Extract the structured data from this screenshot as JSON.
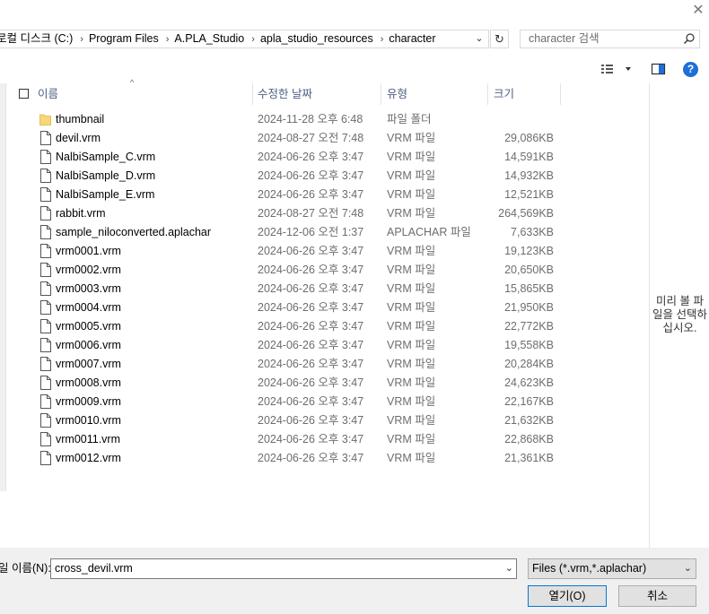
{
  "window": {
    "close_glyph": "✕"
  },
  "address": {
    "crumbs": [
      "로컬 디스크 (C:)",
      "Program Files",
      "A.PLA_Studio",
      "apla_studio_resources",
      "character"
    ],
    "separator": "›",
    "dropdown_glyph": "⌄",
    "refresh_glyph": "↻"
  },
  "search": {
    "placeholder": "character 검색",
    "icon": "search-icon"
  },
  "toolbar": {
    "help_label": "?",
    "view_icon": "view-list-icon",
    "preview_icon": "preview-pane-icon"
  },
  "columns": {
    "name": "이름",
    "date": "수정한 날짜",
    "type": "유형",
    "size": "크기",
    "sort_glyph": "^"
  },
  "files": [
    {
      "name": "thumbnail",
      "date": "2024-11-28 오후 6:48",
      "type": "파일 폴더",
      "size": "",
      "kind": "folder"
    },
    {
      "name": "devil.vrm",
      "date": "2024-08-27 오전 7:48",
      "type": "VRM 파일",
      "size": "29,086KB",
      "kind": "file"
    },
    {
      "name": "NalbiSample_C.vrm",
      "date": "2024-06-26 오후 3:47",
      "type": "VRM 파일",
      "size": "14,591KB",
      "kind": "file"
    },
    {
      "name": "NalbiSample_D.vrm",
      "date": "2024-06-26 오후 3:47",
      "type": "VRM 파일",
      "size": "14,932KB",
      "kind": "file"
    },
    {
      "name": "NalbiSample_E.vrm",
      "date": "2024-06-26 오후 3:47",
      "type": "VRM 파일",
      "size": "12,521KB",
      "kind": "file"
    },
    {
      "name": "rabbit.vrm",
      "date": "2024-08-27 오전 7:48",
      "type": "VRM 파일",
      "size": "264,569KB",
      "kind": "file"
    },
    {
      "name": "sample_niloconverted.aplachar",
      "date": "2024-12-06 오전 1:37",
      "type": "APLACHAR 파일",
      "size": "7,633KB",
      "kind": "file"
    },
    {
      "name": "vrm0001.vrm",
      "date": "2024-06-26 오후 3:47",
      "type": "VRM 파일",
      "size": "19,123KB",
      "kind": "file"
    },
    {
      "name": "vrm0002.vrm",
      "date": "2024-06-26 오후 3:47",
      "type": "VRM 파일",
      "size": "20,650KB",
      "kind": "file"
    },
    {
      "name": "vrm0003.vrm",
      "date": "2024-06-26 오후 3:47",
      "type": "VRM 파일",
      "size": "15,865KB",
      "kind": "file"
    },
    {
      "name": "vrm0004.vrm",
      "date": "2024-06-26 오후 3:47",
      "type": "VRM 파일",
      "size": "21,950KB",
      "kind": "file"
    },
    {
      "name": "vrm0005.vrm",
      "date": "2024-06-26 오후 3:47",
      "type": "VRM 파일",
      "size": "22,772KB",
      "kind": "file"
    },
    {
      "name": "vrm0006.vrm",
      "date": "2024-06-26 오후 3:47",
      "type": "VRM 파일",
      "size": "19,558KB",
      "kind": "file"
    },
    {
      "name": "vrm0007.vrm",
      "date": "2024-06-26 오후 3:47",
      "type": "VRM 파일",
      "size": "20,284KB",
      "kind": "file"
    },
    {
      "name": "vrm0008.vrm",
      "date": "2024-06-26 오후 3:47",
      "type": "VRM 파일",
      "size": "24,623KB",
      "kind": "file"
    },
    {
      "name": "vrm0009.vrm",
      "date": "2024-06-26 오후 3:47",
      "type": "VRM 파일",
      "size": "22,167KB",
      "kind": "file"
    },
    {
      "name": "vrm0010.vrm",
      "date": "2024-06-26 오후 3:47",
      "type": "VRM 파일",
      "size": "21,632KB",
      "kind": "file"
    },
    {
      "name": "vrm0011.vrm",
      "date": "2024-06-26 오후 3:47",
      "type": "VRM 파일",
      "size": "22,868KB",
      "kind": "file"
    },
    {
      "name": "vrm0012.vrm",
      "date": "2024-06-26 오후 3:47",
      "type": "VRM 파일",
      "size": "21,361KB",
      "kind": "file"
    }
  ],
  "preview": {
    "message": [
      "미리 볼 파",
      "일을 선택하",
      "십시오."
    ]
  },
  "bottom": {
    "filename_label": "일 이름(N):",
    "filename_value": "cross_devil.vrm",
    "filetype_value": "Files (*.vrm,*.aplachar)",
    "dropdown_glyph": "⌄",
    "open_label": "열기(O)",
    "cancel_label": "취소"
  },
  "colors": {
    "folder": "#f8d775",
    "accent": "#0078d7",
    "header_text": "#4d6082"
  }
}
